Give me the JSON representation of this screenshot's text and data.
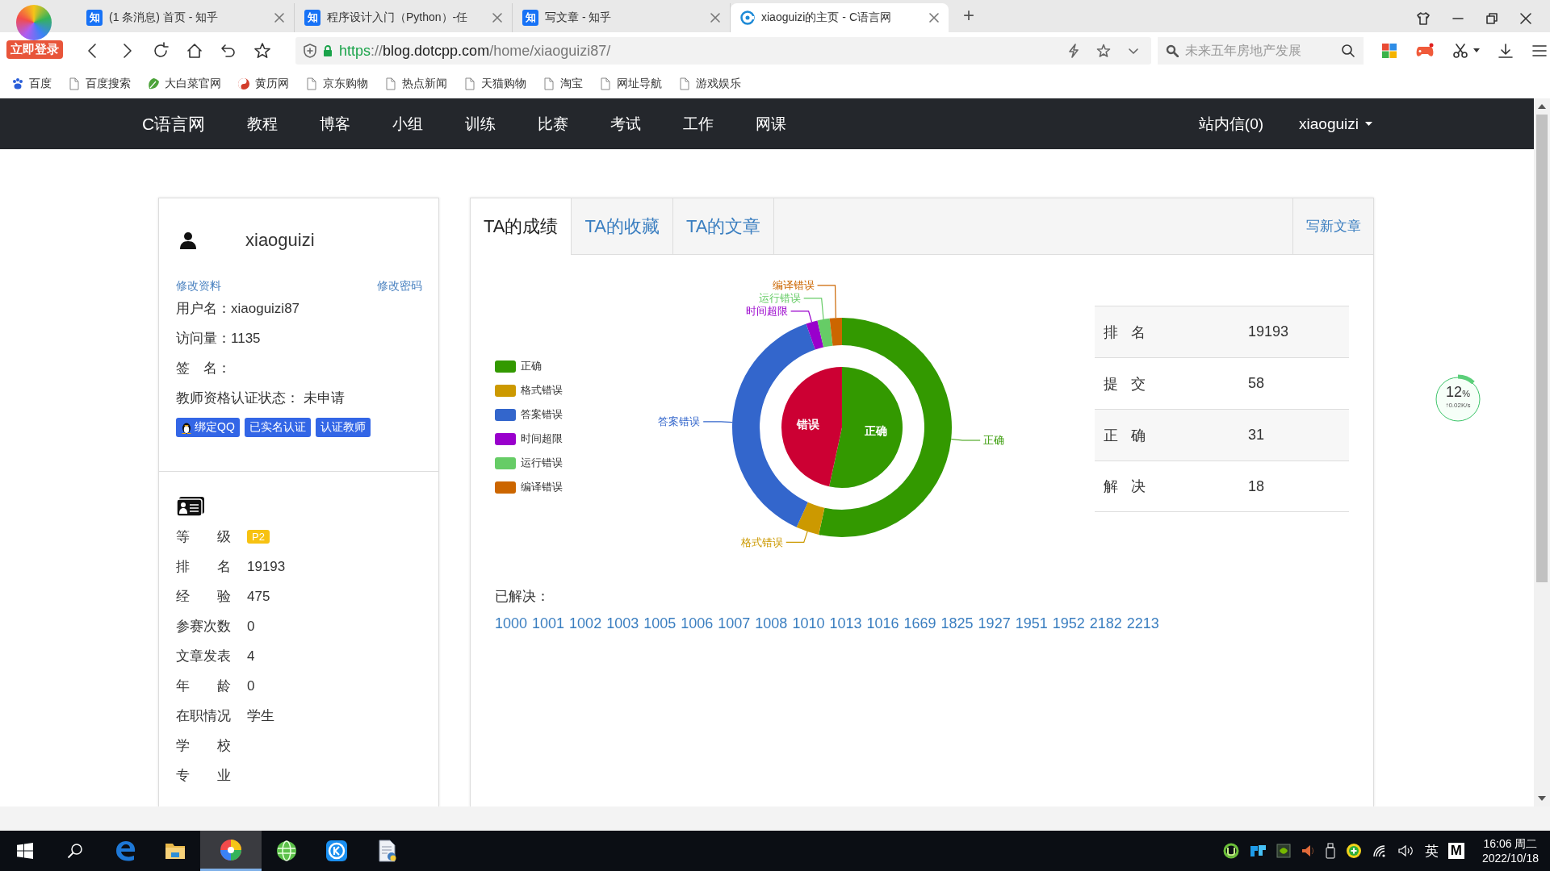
{
  "browser": {
    "login_badge": "立即登录",
    "tabs": [
      {
        "favicon": "知",
        "title": "(1 条消息) 首页 - 知乎",
        "selected": false
      },
      {
        "favicon": "知",
        "title": "程序设计入门（Python）-任",
        "selected": false
      },
      {
        "favicon": "知",
        "title": "写文章 - 知乎",
        "selected": false
      },
      {
        "title": "xiaoguizi的主页 - C语言网",
        "selected": true
      }
    ],
    "new_tab": "+",
    "url": [
      {
        "text": "https",
        "kind": "secure"
      },
      {
        "text": "://",
        "kind": "dim"
      },
      {
        "text": "blog.dotcpp.com",
        "kind": "host"
      },
      {
        "text": "/home/xiaoguizi87/",
        "kind": "dim"
      }
    ],
    "search": {
      "placeholder": "未来五年房地产发展"
    },
    "bookmarks": [
      {
        "label": "百度",
        "kind": "paw"
      },
      {
        "label": "百度搜索",
        "kind": "page"
      },
      {
        "label": "大白菜官网",
        "kind": "leaf"
      },
      {
        "label": "黄历网",
        "kind": "yinyang"
      },
      {
        "label": "京东购物",
        "kind": "page"
      },
      {
        "label": "热点新闻",
        "kind": "page"
      },
      {
        "label": "天猫购物",
        "kind": "page"
      },
      {
        "label": "淘宝",
        "kind": "page"
      },
      {
        "label": "网址导航",
        "kind": "page"
      },
      {
        "label": "游戏娱乐",
        "kind": "page"
      }
    ]
  },
  "site_nav": {
    "brand": "C语言网",
    "items": [
      "教程",
      "博客",
      "小组",
      "训练",
      "比赛",
      "考试",
      "工作",
      "网课"
    ],
    "messages": "站内信(0)",
    "user": "xiaoguizi"
  },
  "profile": {
    "name": "xiaoguizi",
    "links": [
      "修改资料",
      "修改密码"
    ],
    "info": [
      "用户名：xiaoguizi87",
      "访问量：1135",
      "签　名：",
      "教师资格认证状态： 未申请"
    ],
    "badges": [
      {
        "text": "绑定QQ",
        "kind": "penguin"
      },
      {
        "text": "已实名认证"
      },
      {
        "text": "认证教师"
      }
    ],
    "stats": [
      {
        "label": "等级",
        "value": "P2",
        "kind": "badge"
      },
      {
        "label": "排名",
        "value": "19193",
        "kind": "text"
      },
      {
        "label": "经验",
        "value": "475",
        "kind": "text"
      },
      {
        "label": "参赛次数",
        "value": "0",
        "kind": "text"
      },
      {
        "label": "文章发表",
        "value": "4",
        "kind": "text"
      },
      {
        "label": "年龄",
        "value": "0",
        "kind": "text"
      },
      {
        "label": "在职情况",
        "value": "学生",
        "kind": "text"
      },
      {
        "label": "学校"
      },
      {
        "label": "专业"
      }
    ]
  },
  "panel": {
    "tabs": [
      {
        "label": "TA的成绩",
        "selected": true
      },
      {
        "label": "TA的收藏",
        "selected": false
      },
      {
        "label": "TA的文章",
        "selected": false
      }
    ],
    "action": "写新文章",
    "result_chart": {
      "legend": [
        {
          "label": "正确",
          "color": "#339900"
        },
        {
          "label": "格式错误",
          "color": "#cc9900"
        },
        {
          "label": "答案错误",
          "color": "#3366cc"
        },
        {
          "label": "时间超限",
          "color": "#9900cc"
        },
        {
          "label": "运行错误",
          "color": "#66cc66"
        },
        {
          "label": "编译错误",
          "color": "#cc6600"
        }
      ],
      "chart_data": {
        "type": "donut",
        "categories": [
          "正确",
          "格式错误",
          "答案错误",
          "时间超限",
          "运行错误",
          "编译错误"
        ],
        "series": [
          {
            "values": [
              53.4,
              3.4,
              37.9,
              1.7,
              1.8,
              1.8
            ]
          }
        ]
      }
    },
    "summary_chart": {
      "slices": [
        {
          "color": "#339900"
        },
        {
          "color": "#cc0033"
        }
      ],
      "chart_data": {
        "type": "pie",
        "categories": [
          "正确",
          "错误"
        ],
        "series": [
          {
            "values": [
              53.4,
              46.6
            ]
          }
        ]
      }
    },
    "results": [
      {
        "label": "排名",
        "value": "19193"
      },
      {
        "label": "提交",
        "value": "58"
      },
      {
        "label": "正确",
        "value": "31"
      },
      {
        "label": "解决",
        "value": "18"
      }
    ],
    "solved_label": "已解决：",
    "solved": [
      "1000",
      "1001",
      "1002",
      "1003",
      "1005",
      "1006",
      "1007",
      "1008",
      "1010",
      "1013",
      "1016",
      "1669",
      "1825",
      "1927",
      "1951",
      "1952",
      "2182",
      "2213"
    ]
  },
  "speed_widget": {
    "value": "12",
    "unit": "%",
    "speed": "↑0.02K/s"
  },
  "taskbar": {
    "apps": [
      {
        "kind": "edge",
        "active": false
      },
      {
        "kind": "folder",
        "active": false
      },
      {
        "kind": "pinwheel",
        "active": true
      },
      {
        "kind": "globe",
        "active": false
      },
      {
        "kind": "kapp",
        "active": false
      },
      {
        "kind": "document",
        "active": false
      }
    ],
    "ime": "英",
    "ime_mode": "M",
    "time": "16:06 周二",
    "date": "2022/10/18"
  }
}
